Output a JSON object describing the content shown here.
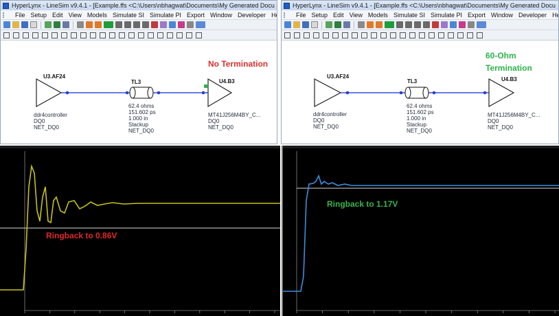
{
  "left": {
    "title": "HyperLynx - LineSim v9.4.1 - [Example.ffs <C:\\Users\\nbhagwat\\Documents\\My Generated Docu",
    "menu": [
      "File",
      "Setup",
      "Edit",
      "View",
      "Models",
      "Simulate SI",
      "Simulate PI",
      "Export",
      "Window",
      "Developer",
      "Help"
    ],
    "driver": {
      "ref": "U3.AF24",
      "model": "ddr4controller",
      "pin": "DQ0",
      "net": "NET_DQ0"
    },
    "line": {
      "ref": "TL3",
      "impedance": "62.4 ohms",
      "delay": "151.602 ps",
      "length": "1.000 in",
      "type": "Stackup",
      "net": "NET_DQ0"
    },
    "receiver": {
      "ref": "U4.B3",
      "model": "MT41J256M4BY_C...",
      "pin": "DQ0",
      "net": "NET_DQ0"
    },
    "callout_line1": "No Termination",
    "callout_line2": "",
    "annotation": "Ringback to 0.86V"
  },
  "right": {
    "title": "HyperLynx - LineSim v9.4.1 - [Example.ffs <C:\\Users\\nbhagwat\\Documents\\My Generated Docu",
    "menu": [
      "File",
      "Setup",
      "Edit",
      "View",
      "Models",
      "Simulate SI",
      "Simulate PI",
      "Export",
      "Window",
      "Developer",
      "Help"
    ],
    "driver": {
      "ref": "U3.AF24",
      "model": "ddr4controller",
      "pin": "DQ0",
      "net": "NET_DQ0"
    },
    "line": {
      "ref": "TL3",
      "impedance": "62.4 ohms",
      "delay": "151.602 ps",
      "length": "1.000 in",
      "type": "Stackup",
      "net": "NET_DQ0"
    },
    "receiver": {
      "ref": "U4.B3",
      "model": "MT41J256M4BY_C...",
      "pin": "DQ0",
      "net": "NET_DQ0"
    },
    "callout_line1": "60-Ohm",
    "callout_line2": "Termination",
    "annotation": "Ringback to 1.17V"
  },
  "colors": {
    "no_term_callout": "#d9302c",
    "term_callout": "#2db34a",
    "left_trace": "#c8c21a",
    "right_trace": "#3b8fe0",
    "left_annotation": "#e0282a",
    "right_annotation": "#39b54a",
    "net_wire": "#3a4fd8"
  }
}
